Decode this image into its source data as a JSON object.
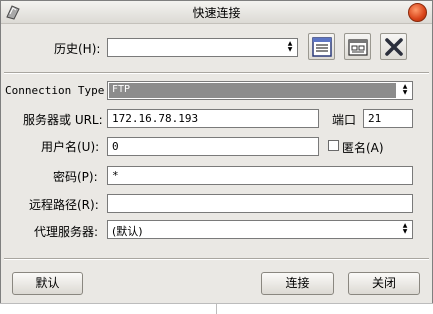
{
  "window": {
    "title": "快速连接"
  },
  "history": {
    "label": "历史(H):",
    "value": ""
  },
  "connection_type": {
    "label": "Connection Type:",
    "value": "FTP"
  },
  "server": {
    "label": "服务器或 URL:",
    "value": "172.16.78.193"
  },
  "port": {
    "label": "端口",
    "value": "21"
  },
  "username": {
    "label": "用户名(U):",
    "value": "0"
  },
  "anonymous": {
    "label": "匿名(A)",
    "checked": false
  },
  "password": {
    "label": "密码(P):",
    "value": "*"
  },
  "remote_path": {
    "label": "远程路径(R):",
    "value": ""
  },
  "proxy": {
    "label": "代理服务器:",
    "value": "(默认)"
  },
  "buttons": {
    "default": "默认",
    "connect": "连接",
    "close": "关闭"
  },
  "colors": {
    "close_red": "#d9441a",
    "selection_gray": "#8c8c8c",
    "delete_x": "#2b2f3c"
  },
  "icons": [
    "app-icon",
    "close-icon",
    "bookmark-list-icon",
    "edit-bookmarks-icon",
    "delete-icon"
  ]
}
